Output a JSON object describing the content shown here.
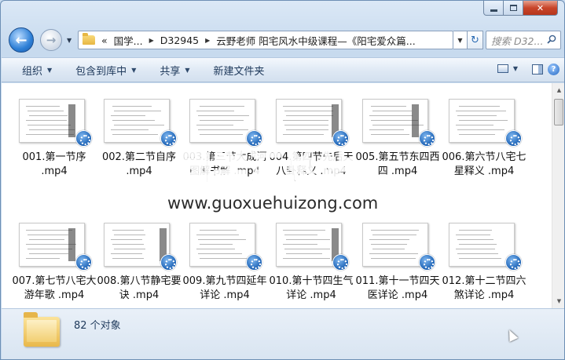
{
  "window": {
    "minimize_glyph": "",
    "close_glyph": "✕"
  },
  "nav": {
    "back_glyph": "←",
    "forward_glyph": "→"
  },
  "address": {
    "crumb_more": "«",
    "crumb1": "国学...",
    "crumb2": "D32945",
    "current": "云野老师 阳宅风水中级课程—《阳宅爱众篇..."
  },
  "search": {
    "placeholder": "搜索 D32..."
  },
  "toolbar": {
    "organize": "组织",
    "include_library": "包含到库中",
    "share": "共享",
    "new_folder": "新建文件夹"
  },
  "files": [
    {
      "line1": "001.第一节序",
      "line2": ".mp4"
    },
    {
      "line1": "002.第二节自序",
      "line2": ".mp4"
    },
    {
      "line1": "003.第三节大成河",
      "line2": "图解书解 .mp4"
    },
    {
      "line1": "004.第四节先后天",
      "line2": "八卦释义 .mp4"
    },
    {
      "line1": "005.第五节东四西",
      "line2": "四 .mp4"
    },
    {
      "line1": "006.第六节八宅七",
      "line2": "星释义 .mp4"
    },
    {
      "line1": "007.第七节八宅大",
      "line2": "游年歌 .mp4"
    },
    {
      "line1": "008.第八节静宅要",
      "line2": "诀 .mp4"
    },
    {
      "line1": "009.第九节四延年",
      "line2": "详论 .mp4"
    },
    {
      "line1": "010.第十节四生气",
      "line2": "详论 .mp4"
    },
    {
      "line1": "011.第十一节四天",
      "line2": "医详论 .mp4"
    },
    {
      "line1": "012.第十二节四六",
      "line2": "煞详论 .mp4"
    }
  ],
  "watermark": {
    "title": "国学汇总站",
    "url": "www.guoxuehuizong.com"
  },
  "details": {
    "count": "82 个对象"
  }
}
